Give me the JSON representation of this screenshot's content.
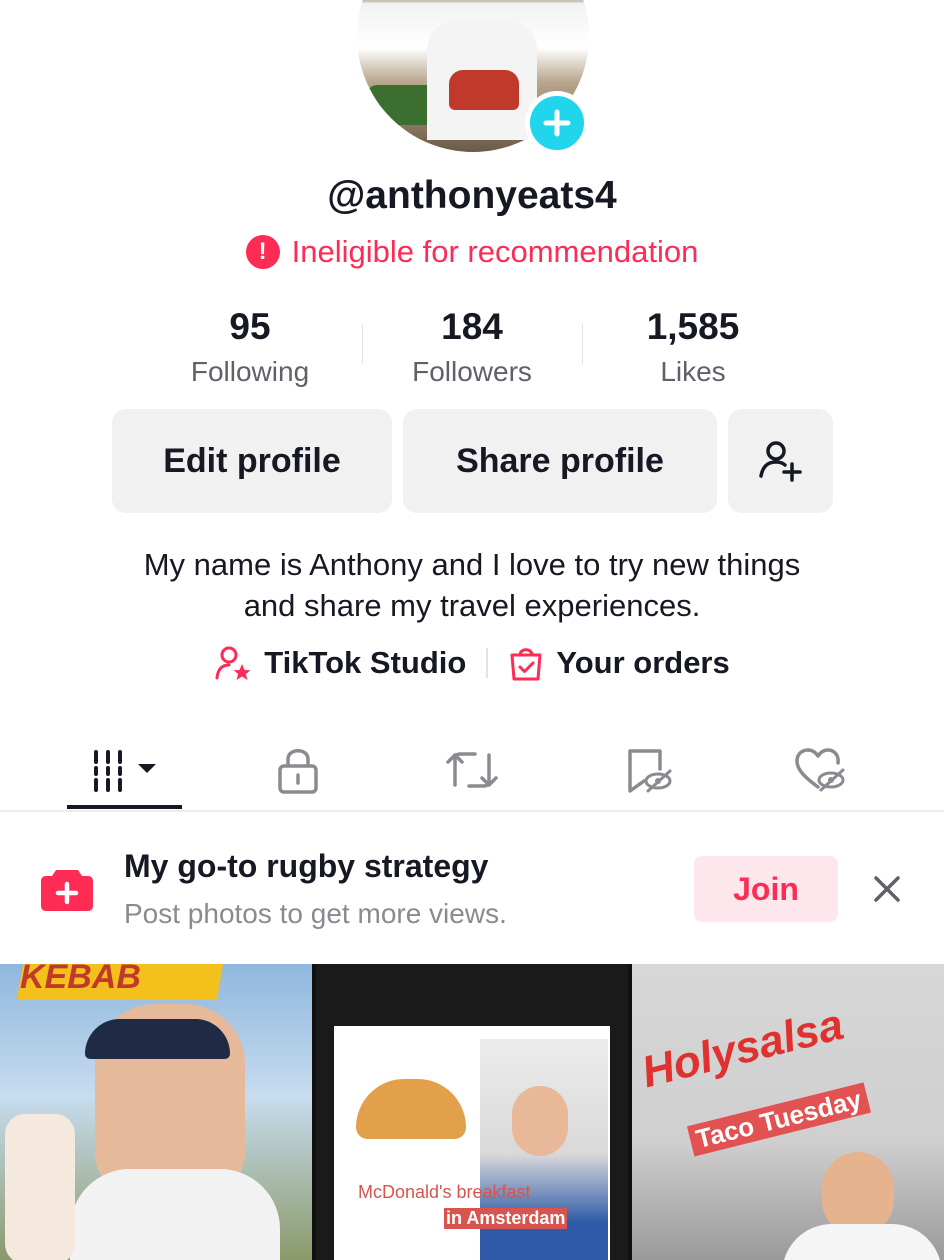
{
  "profile": {
    "username": "@anthonyeats4",
    "warning": "Ineligible for recommendation",
    "bio_line1": "My name is Anthony and I love to try new things",
    "bio_line2": "and share my travel experiences."
  },
  "stats": {
    "following": {
      "value": "95",
      "label": "Following"
    },
    "followers": {
      "value": "184",
      "label": "Followers"
    },
    "likes": {
      "value": "1,585",
      "label": "Likes"
    }
  },
  "actions": {
    "edit_profile": "Edit profile",
    "share_profile": "Share profile"
  },
  "links": {
    "studio": "TikTok Studio",
    "orders": "Your orders"
  },
  "tabs": [
    "videos-tab",
    "private-tab",
    "reposts-tab",
    "favorites-tab",
    "liked-tab"
  ],
  "banner": {
    "title": "My go-to rugby strategy",
    "subtitle": "Post photos to get more views.",
    "join": "Join"
  },
  "videos": [
    {
      "overlay": "KEBAB"
    },
    {
      "overlay_1": "McDonald's breakfast",
      "overlay_2": "in Amsterdam"
    },
    {
      "overlay_1": "Holysalsa",
      "overlay_2": "Taco Tuesday"
    }
  ],
  "colors": {
    "accent": "#fe2c55",
    "badge": "#20d5ec",
    "text": "#161823"
  }
}
